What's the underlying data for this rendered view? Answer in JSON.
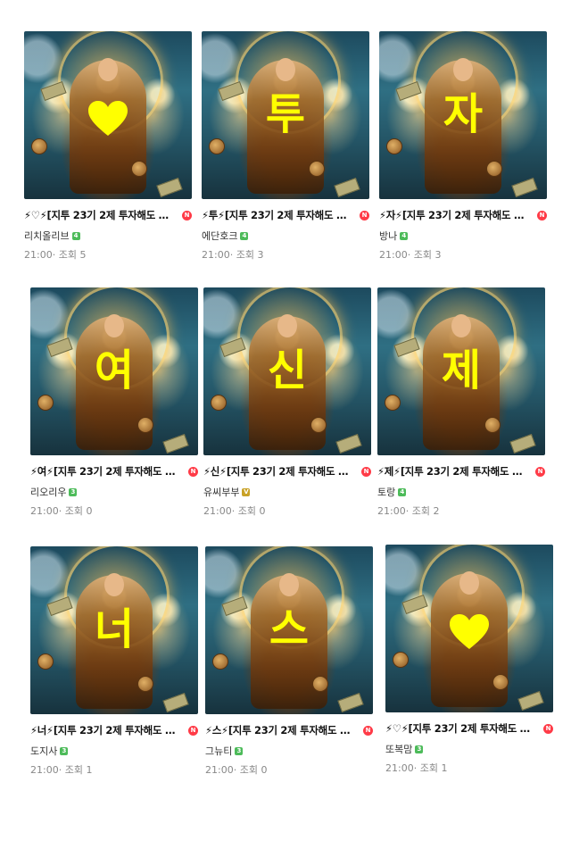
{
  "cards": [
    {
      "overlay": "♥",
      "overlay_is_heart": true,
      "title": "⚡♡⚡[지투 23기 2제 투자해도 …",
      "new_badge": "N",
      "author": "리치올리브",
      "level": "4",
      "level_color": "#4dbb5a",
      "time": "21:00·",
      "views": "조회 5"
    },
    {
      "overlay": "투",
      "title": "⚡투⚡[지투 23기 2제 투자해도 …",
      "new_badge": "N",
      "author": "에단호크",
      "level": "4",
      "level_color": "#4dbb5a",
      "time": "21:00·",
      "views": "조회 3"
    },
    {
      "overlay": "자",
      "title": "⚡자⚡[지투 23기 2제 투자해도 …",
      "new_badge": "N",
      "author": "방나",
      "level": "4",
      "level_color": "#4dbb5a",
      "time": "21:00·",
      "views": "조회 3"
    },
    {
      "overlay": "여",
      "title": "⚡여⚡[지투 23기 2제 투자해도 …",
      "new_badge": "N",
      "author": "리오리우",
      "level": "3",
      "level_color": "#4dbb5a",
      "time": "21:00·",
      "views": "조회 0"
    },
    {
      "overlay": "신",
      "title": "⚡신⚡[지투 23기 2제 투자해도 …",
      "new_badge": "N",
      "author": "유씨부부",
      "level": "V",
      "level_color": "#c9a227",
      "time": "21:00·",
      "views": "조회 0"
    },
    {
      "overlay": "제",
      "title": "⚡제⚡[지투 23기 2제 투자해도 …",
      "new_badge": "N",
      "author": "토랑",
      "level": "4",
      "level_color": "#4dbb5a",
      "time": "21:00·",
      "views": "조회 2"
    },
    {
      "overlay": "너",
      "title": "⚡너⚡[지투 23기 2제 투자해도 …",
      "new_badge": "N",
      "author": "도지사",
      "level": "3",
      "level_color": "#4dbb5a",
      "time": "21:00·",
      "views": "조회 1"
    },
    {
      "overlay": "스",
      "title": "⚡스⚡[지투 23기 2제 투자해도 …",
      "new_badge": "N",
      "author": "그뉴티",
      "level": "3",
      "level_color": "#4dbb5a",
      "time": "21:00·",
      "views": "조회 0"
    },
    {
      "overlay": "♥",
      "overlay_is_heart": true,
      "title": "⚡♡⚡[지투 23기 2제 투자해도 …",
      "new_badge": "N",
      "author": "또복맘",
      "level": "3",
      "level_color": "#4dbb5a",
      "time": "21:00·",
      "views": "조회 1"
    }
  ]
}
